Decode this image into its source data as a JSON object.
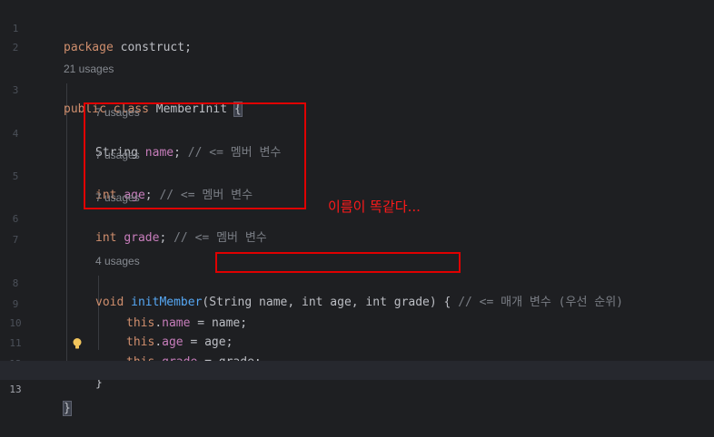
{
  "lines": [
    {
      "num": "1",
      "code": "package construct;"
    },
    {
      "num": "2"
    },
    {
      "hint": "21 usages"
    },
    {
      "num": "3",
      "kw": "public class",
      "name": "MemberInit",
      "brace": "{"
    },
    {
      "hint": "7 usages"
    },
    {
      "num": "4",
      "type": "String",
      "field": "name",
      "comment": "// <= 멤버 변수"
    },
    {
      "hint": "7 usages"
    },
    {
      "num": "5",
      "type": "int",
      "field": "age",
      "comment": "// <= 멤버 변수"
    },
    {
      "hint": "7 usages"
    },
    {
      "num": "6",
      "type": "int",
      "field": "grade",
      "comment": "// <= 멤버 변수"
    },
    {
      "num": "7"
    },
    {
      "hint": "4 usages"
    },
    {
      "num": "8",
      "ret": "void",
      "method": "initMember",
      "params": "String name, int age, int grade",
      "comment": "// <= 매개 변수 (우선 순위)"
    },
    {
      "num": "9",
      "kw": "this",
      "field": "name",
      "rhs": "name"
    },
    {
      "num": "10",
      "kw": "this",
      "field": "age",
      "rhs": "age"
    },
    {
      "num": "11",
      "kw": "this",
      "field": "grade",
      "rhs": "grade"
    },
    {
      "num": "12",
      "brace": "}"
    },
    {
      "num": "13",
      "brace": "}"
    }
  ],
  "annotation": {
    "text": "이름이 똑같다..."
  },
  "colors": {
    "box": "#e00000",
    "annotation": "#ff1a1a"
  }
}
